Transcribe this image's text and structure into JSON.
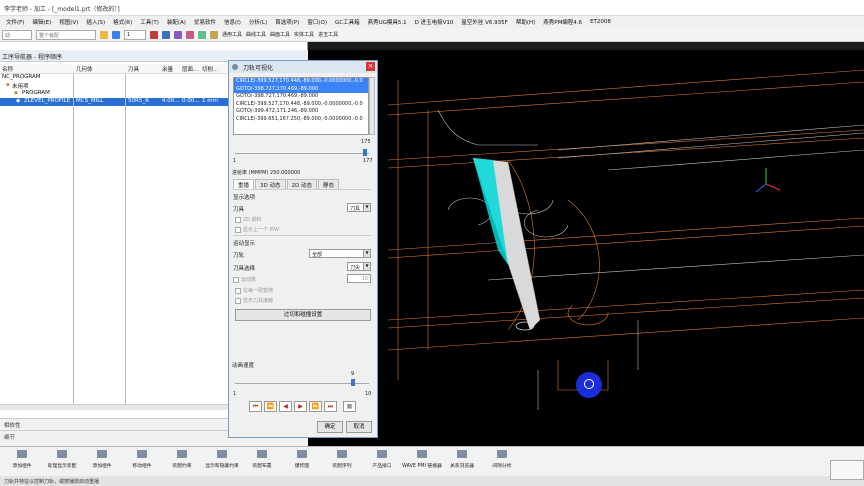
{
  "window": {
    "title": "李学老师 - 加工 - [_model1.prt（修改的）]",
    "controls": [
      "−",
      "□",
      "×"
    ]
  },
  "menu": [
    "文件(F)",
    "编辑(E)",
    "视图(V)",
    "插入(S)",
    "格式(R)",
    "工具(T)",
    "装配(A)",
    "优易软件",
    "信息(I)",
    "分析(L)",
    "首选项(P)",
    "窗口(O)",
    "GC工具箱",
    "燕秀UG模具5.1",
    "D 进玉电极V10",
    "星空外挂 V6.935F",
    "帮助(H)",
    "燕秀PM编程4.6",
    "ET2008"
  ],
  "toolbar": {
    "left_combo": "动",
    "filter_combo": "整个装配",
    "count_combo": "1",
    "items": [
      "通用工具",
      "曲线工具",
      "曲面工具",
      "实体工具",
      "进玉工具"
    ]
  },
  "navigator": {
    "title": "工序导航器 - 程序顺序",
    "columns": [
      "名称",
      "几何体",
      "刀具",
      "余量",
      "层面...",
      "切削..."
    ],
    "rows": [
      {
        "name": "NC_PROGRAM",
        "geometry": "",
        "tool": "",
        "stock": "",
        "depth": "",
        "cut": ""
      },
      {
        "name": "未用项",
        "geometry": "",
        "tool": "",
        "stock": "",
        "depth": "",
        "cut": ""
      },
      {
        "name": "PROGRAM",
        "geometry": "",
        "tool": "",
        "stock": "",
        "depth": "",
        "cut": ""
      },
      {
        "name": "ZLEVEL_PROFILE",
        "geometry": "MCS_MILL",
        "tool": "50R5_R",
        "stock": "4.00...",
        "depth": "0.00...",
        "cut": "1 mm"
      }
    ],
    "bottom_sections": [
      "相依性",
      "细节"
    ]
  },
  "dialog": {
    "title": "刀轨可视化",
    "commands": [
      "CIRCLE/-399.527,170.448,-89.000,-0.0000000,-0.0",
      "GOTO/-398.727,170.469,-89.000",
      "GOTO/-398.727,170.469,-89.000",
      "CIRCLE/-399.527,170.448,-89.000,-0.0000000,-0.0",
      "GOTO/-399.472,171.246,-89.000",
      "CIRCLE/-399.651,167.250,-89.000,-0.0000000,-0.0"
    ],
    "slider_value": "175",
    "slider_min": "1",
    "slider_max": "177",
    "slider_fraction": 0.983,
    "feed_label": "进给率 (MMPM) 250.000000",
    "tabs": [
      "重播",
      "3D 动态",
      "2D 动态",
      "静态"
    ],
    "display_options": "显示选项",
    "tool_label": "刀具",
    "tool_value": "刀具",
    "chk_2d": "2D 颜料",
    "chk_prev": "显示上一个 IPW",
    "motion_display": "运动显示",
    "path_label": "刀轨",
    "path_value": "全部",
    "tool_select_label": "刀具选择",
    "tool_select_value": "刀尖",
    "motion_label": "运动数",
    "motion_value": "10",
    "chk_stop": "在每一层暂停",
    "chk_contact": "显示刀具接触",
    "over_cut_btn": "过切和碰撞设置",
    "anim_speed": "动画速度",
    "speed_value": "9",
    "speed_min": "1",
    "speed_max": "10",
    "speed_fraction": 0.889,
    "play_controls": [
      "⏮",
      "⏪",
      "◀",
      "▶",
      "⏩",
      "⏭",
      "■"
    ],
    "ok": "确定",
    "cancel": "取消"
  },
  "bottom_toolbar": [
    "添加组件",
    "处理显示装配",
    "添加组件",
    "移动组件",
    "装配约束",
    "显示和隐藏约束",
    "装配布置",
    "爆炸图",
    "装配序列",
    "产品接口",
    "WAVE PMI 链接器",
    "关系浏览器",
    "间隙分析"
  ],
  "status": "刀轨并特征以控制刀轨，或按播放启动重播",
  "colors": {
    "viewport_bg": "#000000",
    "accent": "#2a6fd6",
    "toolpath": "#e07a2a",
    "tool": "#d8d8d8",
    "cyan": "#00d5d5"
  }
}
